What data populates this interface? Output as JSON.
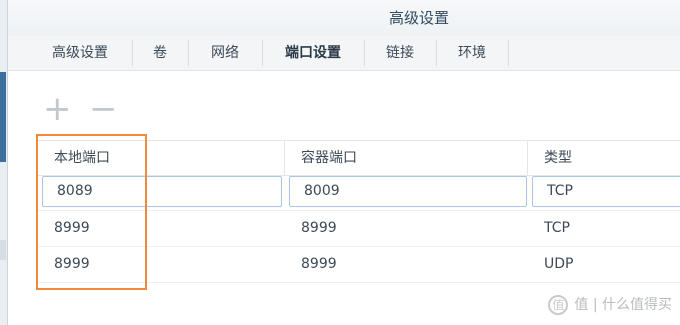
{
  "window": {
    "title": "高级设置"
  },
  "tabs": [
    {
      "label": "高级设置"
    },
    {
      "label": "卷"
    },
    {
      "label": "网络"
    },
    {
      "label": "端口设置",
      "active": true
    },
    {
      "label": "链接"
    },
    {
      "label": "环境"
    }
  ],
  "toolbar": {
    "add_icon": "plus-icon",
    "remove_icon": "minus-icon",
    "add_glyph": "+",
    "remove_glyph": "−"
  },
  "table": {
    "headers": [
      "本地端口",
      "容器端口",
      "类型"
    ],
    "rows": [
      {
        "local": "8089",
        "container": "8009",
        "type": "TCP"
      },
      {
        "local": "8999",
        "container": "8999",
        "type": "TCP"
      },
      {
        "local": "8999",
        "container": "8999",
        "type": "UDP"
      }
    ]
  },
  "watermark": {
    "text": "值 | 什么值得买",
    "icon": "zhi-logo-icon"
  },
  "colors": {
    "highlight": "#f08a3a",
    "edit_border": "#a9c7e4",
    "title_text": "#324a5e"
  }
}
